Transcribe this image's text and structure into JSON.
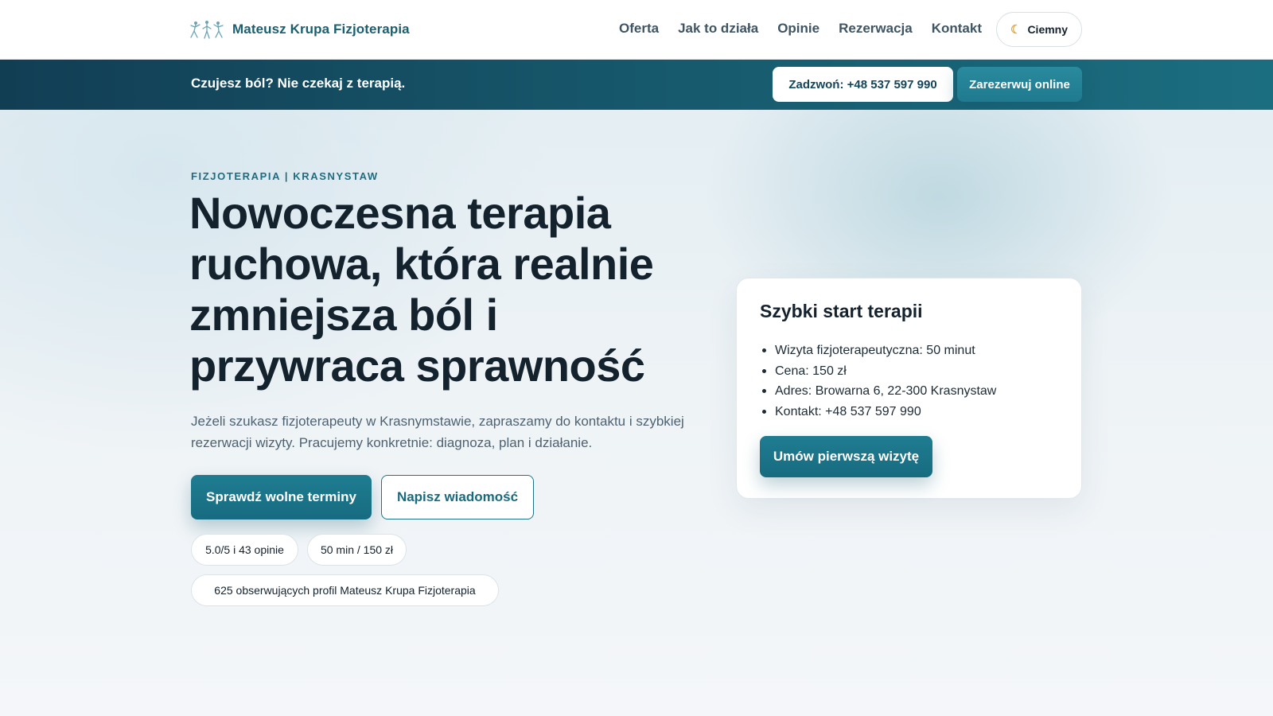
{
  "header": {
    "brand_name": "Mateusz Krupa Fizjoterapia",
    "logo_icon": "physiotherapy-figure-icon",
    "nav": [
      {
        "label": "Oferta"
      },
      {
        "label": "Jak to działa"
      },
      {
        "label": "Opinie"
      },
      {
        "label": "Rezerwacja"
      },
      {
        "label": "Kontakt"
      }
    ],
    "theme_toggle": {
      "label": "Ciemny",
      "icon": "moon-icon"
    }
  },
  "promo_strip": {
    "text": "Czujesz ból? Nie czekaj z terapią.",
    "call_label": "Zadzwoń: +48 537 597 990",
    "book_label": "Zarezerwuj online"
  },
  "hero": {
    "eyebrow": "FIZJOTERAPIA | KRASNYSTAW",
    "title": "Nowoczesna terapia ruchowa, która realnie zmniejsza ból i przywraca sprawność",
    "lead": "Jeżeli szukasz fizjoterapeuty w Krasnymstawie, zapraszamy do kontaktu i szybkiej rezerwacji wizyty. Pracujemy konkretnie: diagnoza, plan i działanie.",
    "primary_cta": "Sprawdź wolne terminy",
    "secondary_cta": "Napisz wiadomość",
    "chips": {
      "rating": "5.0/5 i 43 opinie",
      "price": "50 min / 150 zł",
      "followers": "625 obserwujących profil Mateusz Krupa Fizjoterapia"
    }
  },
  "card": {
    "title": "Szybki start terapii",
    "items": [
      "Wizyta fizjoterapeutyczna: 50 minut",
      "Cena: 150 zł",
      "Adres: Browarna 6, 22-300 Krasnystaw",
      "Kontakt: +48 537 597 990"
    ],
    "cta": "Umów pierwszą wizytę"
  },
  "colors": {
    "accent": "#1f7d91",
    "brand_text": "#1a5f70",
    "strip_dark": "#123e54",
    "heading": "#14222e"
  }
}
